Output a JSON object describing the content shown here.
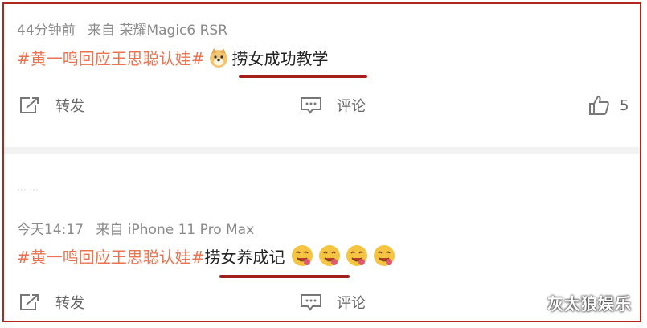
{
  "posts": [
    {
      "time": "44分钟前",
      "source": "来自 荣耀Magic6 RSR",
      "hashtag": "#黄一鸣回应王思聪认娃#",
      "emoji": "doge",
      "text": "捞女成功教学",
      "actions": {
        "repost": "转发",
        "comment": "评论",
        "like_count": "5"
      }
    },
    {
      "time": "今天14:17",
      "source": "来自 iPhone 11 Pro Max",
      "hashtag": "#黄一鸣回应王思聪认娃#",
      "text": "捞女养成记",
      "emojis": [
        "yummy-face",
        "yummy-face",
        "yummy-face",
        "yummy-face"
      ],
      "actions": {
        "repost": "转发",
        "comment": "评论"
      }
    }
  ],
  "watermark": "灰太狼娱乐",
  "colors": {
    "hashtag": "#eb7350",
    "underline": "#a3201a",
    "frame": "#b3261e"
  }
}
